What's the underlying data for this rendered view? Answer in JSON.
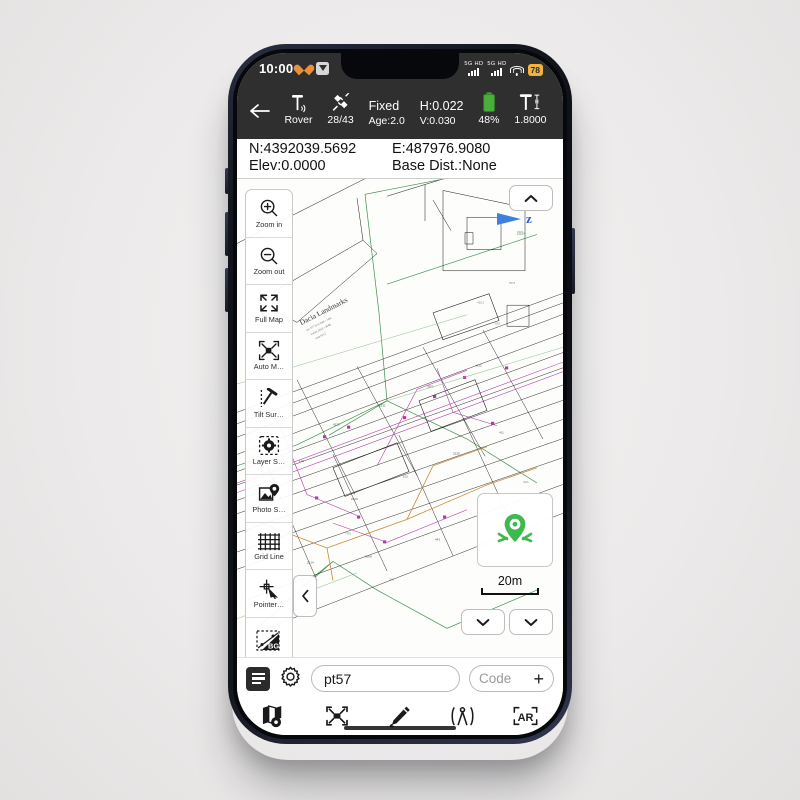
{
  "status_bar": {
    "time": "10:00",
    "icons": [
      "heart-icon",
      "app-icon"
    ],
    "signal_1_label": "5G HD",
    "signal_2_label": "5G HD",
    "wifi": "wifi-icon",
    "battery_level": "78"
  },
  "app_bar": {
    "back": "back-arrow",
    "items": [
      {
        "icon": "rover-antenna-icon",
        "value": "",
        "sub": "Rover"
      },
      {
        "icon": "satellite-icon",
        "value": "",
        "sub": "28/43"
      },
      {
        "icon": "",
        "value": "Fixed",
        "sub": "Age:2.0"
      },
      {
        "icon": "",
        "value": "H:0.022",
        "sub": "V:0.030"
      },
      {
        "icon": "battery-icon",
        "value": "",
        "sub": "48%"
      },
      {
        "icon": "antenna-height-icon",
        "value": "",
        "sub": "1.8000"
      }
    ],
    "solution_status": "Fixed",
    "age": "Age:2.0",
    "h_precision": "H:0.022",
    "v_precision": "V:0.030",
    "battery_percent": "48%",
    "antenna_height": "1.8000",
    "antenna_height_label": "H I",
    "rover_label": "Rover",
    "satellites": "28/43"
  },
  "coordinates": {
    "northing": "N:4392039.5692",
    "easting": "E:487976.9080",
    "elevation": "Elev:0.0000",
    "base_distance": "Base Dist.:None"
  },
  "left_toolbar": [
    {
      "icon": "zoom-in-icon",
      "label": "Zoom in"
    },
    {
      "icon": "zoom-out-icon",
      "label": "Zoom out"
    },
    {
      "icon": "full-map-icon",
      "label": "Full Map"
    },
    {
      "icon": "auto-move-icon",
      "label": "Auto M…"
    },
    {
      "icon": "layer-settings-icon",
      "label": "Layer S…"
    },
    {
      "icon": "photo-settings-icon",
      "label": "Photo S…"
    },
    {
      "icon": "grid-line-icon",
      "label": "Grid Line"
    },
    {
      "icon": "pointer-icon",
      "label": "Pointer…"
    },
    {
      "icon": "background-icon",
      "label": "BG"
    }
  ],
  "map": {
    "scale_label": "20m",
    "north_arrow_label": "z",
    "north_arrow_sub": "884",
    "gps_widget": "gps-locate-icon",
    "collapse_button": "chevron-left-icon",
    "expand_button": "chevron-up-icon",
    "dropdown_1": "chevron-down-icon",
    "dropdown_2": "chevron-down-icon",
    "parcel_label": "Dacia Landmarks"
  },
  "entry_bar": {
    "menu": "menu-icon",
    "settings": "gear-icon",
    "point_name_value": "pt57",
    "point_name_placeholder": "pt57",
    "code_label": "Code",
    "code_add": "+"
  },
  "bottom_nav": [
    {
      "icon": "map-config-icon",
      "label": ""
    },
    {
      "icon": "survey-point-icon",
      "label": ""
    },
    {
      "icon": "edit-pencil-icon",
      "label": ""
    },
    {
      "icon": "compass-divider-icon",
      "label": ""
    },
    {
      "icon": "ar-icon",
      "label": "AR"
    }
  ],
  "colors": {
    "appbar_bg": "#2f2f2f",
    "battery_badge": "#f2b33d",
    "gps_green": "#3fb84f",
    "north_blue": "#3f7fe0"
  }
}
